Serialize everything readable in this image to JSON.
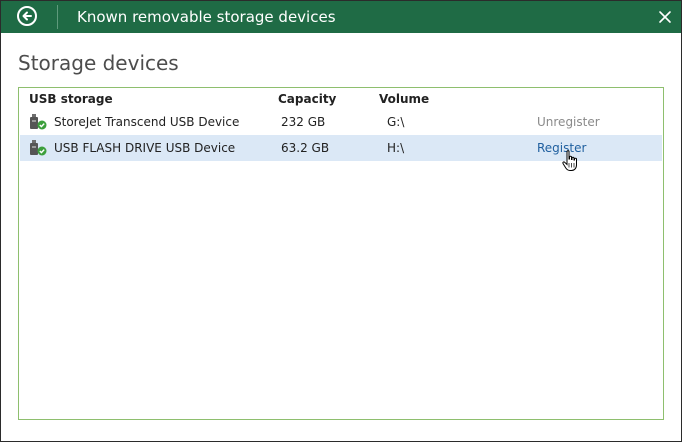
{
  "window": {
    "title": "Known removable storage devices"
  },
  "section": {
    "heading": "Storage devices"
  },
  "table": {
    "columns": [
      "USB storage",
      "Capacity",
      "Volume"
    ],
    "rows": [
      {
        "name": "StoreJet Transcend USB Device",
        "capacity": "232 GB",
        "volume": "G:\\",
        "action": "Unregister",
        "selected": false
      },
      {
        "name": "USB FLASH DRIVE USB Device",
        "capacity": "63.2 GB",
        "volume": "H:\\",
        "action": "Register",
        "selected": true
      }
    ]
  },
  "icons": {
    "back": "back-arrow-circle-icon",
    "close": "close-icon",
    "device": "usb-drive-check-icon",
    "cursor": "hand-pointer-icon"
  },
  "colors": {
    "titlebar": "#1f6b45",
    "panel_border": "#8ebf6e",
    "selected_row": "#dbe8f6",
    "link": "#1f5f9f",
    "disabled_link": "#8a8a8a"
  }
}
